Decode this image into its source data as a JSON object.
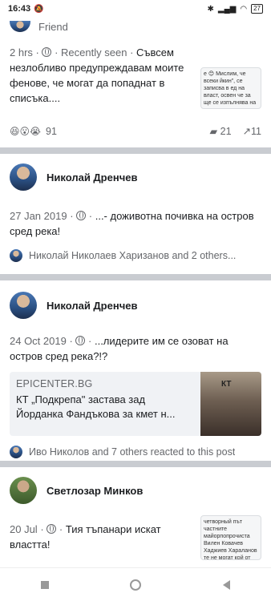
{
  "status": {
    "time": "16:43",
    "battery": "27"
  },
  "post1": {
    "header_name": "Friend",
    "time": "2 hrs",
    "seen": "Recently seen",
    "text": "Съвсем незлобливо предупреждавам моите фенове, че могат да попаднат в списъка....",
    "thumb_text": "е 😊 Мислим, че всеки йкин\", се записва в ед на власт, освен че за ще се изпълнява на о",
    "reaction_count": "91",
    "comments": "21",
    "shares": "11"
  },
  "post2": {
    "name": "Николай Дренчев",
    "time": "27 Jan 2019",
    "text": "...- доживотна почивка на остров сред река!",
    "reactors": "Николай Николаев Харизанов and 2 others..."
  },
  "post3": {
    "name": "Николай Дренчев",
    "time": "24 Oct 2019",
    "text": "...лидерите им се озоват на остров сред река?!?",
    "link_domain": "EPICENTER.BG",
    "link_title": "КТ „Подкрепа\" застава зад Йорданка Фандъкова за кмет н...",
    "link_pic_text": "КТ",
    "reactors": "Иво Николов and 7 others reacted to this post"
  },
  "post4": {
    "name": "Светлозар Минков",
    "time": "20 Jul",
    "text": "Тия тъпанари искат властта!",
    "thumb_text": "четворный път частните майорпопрочиста Вилен Ковачев Хаджиев Хараланов те не могат кой от Българскира Партия не бъде..."
  }
}
